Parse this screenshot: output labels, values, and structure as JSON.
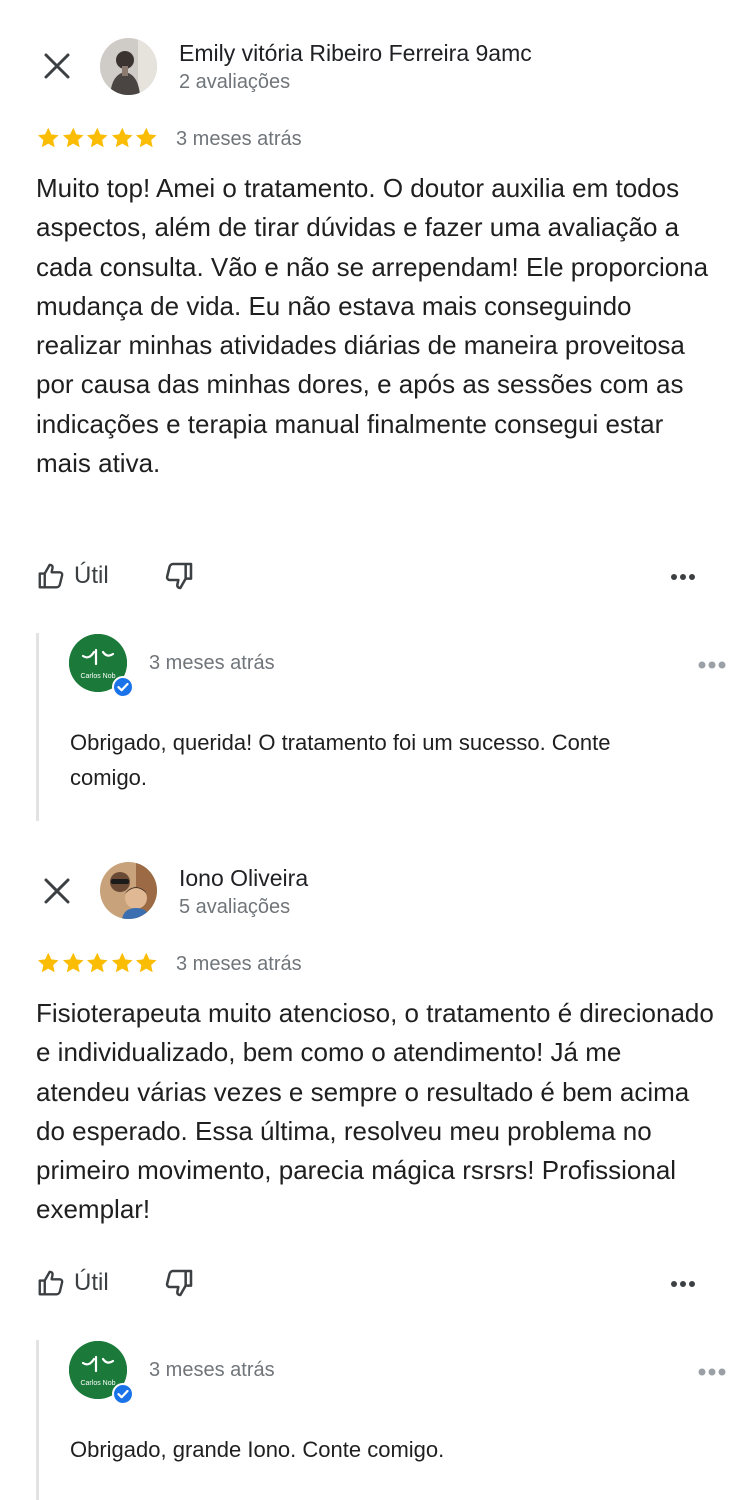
{
  "reviews": [
    {
      "author": "Emily vitória Ribeiro Ferreira 9amc",
      "review_count": "2 avaliações",
      "rating": 5,
      "date": "3 meses atrás",
      "text": "Muito top! Amei o tratamento. O doutor auxilia em todos aspectos, além de tirar dúvidas e fazer uma avaliação a cada consulta. Vão e não se arrependam! Ele proporciona mudança de vida. Eu não estava mais conseguindo realizar minhas atividades diárias de maneira proveitosa por causa das minhas dores, e após as sessões com as indicações e terapia manual finalmente consegui estar mais ativa.",
      "useful_label": "Útil",
      "reply": {
        "date": "3 meses atrás",
        "text": "Obrigado, querida! O tratamento foi um sucesso. Conte comigo."
      }
    },
    {
      "author": "Iono Oliveira",
      "review_count": "5 avaliações",
      "rating": 5,
      "date": "3 meses atrás",
      "text": "Fisioterapeuta muito atencioso, o tratamento é direcionado e individualizado, bem como o atendimento! Já me atendeu várias vezes e sempre o resultado é bem acima do esperado. Essa última, resolveu meu problema no primeiro movimento, parecia mágica rsrsrs! Profissional exemplar!",
      "useful_label": "Útil",
      "reply": {
        "date": "3 meses atrás",
        "text": "Obrigado, grande Iono. Conte comigo."
      }
    }
  ],
  "owner_logo_text": "Carlos Nob",
  "colors": {
    "star": "#fbbc04",
    "verified": "#1a73e8",
    "owner_logo_bg": "#1b7a3a",
    "muted_text": "#70757a"
  }
}
